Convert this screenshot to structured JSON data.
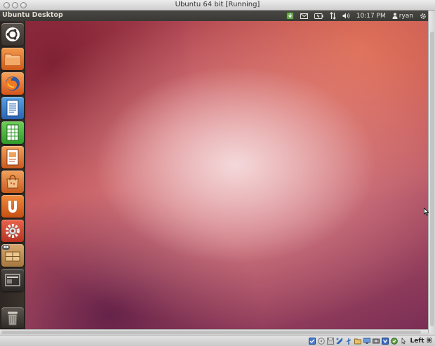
{
  "window": {
    "title": "Ubuntu 64 bit [Running]"
  },
  "panel": {
    "title": "Ubuntu Desktop",
    "time": "10:17 PM",
    "user": "ryan"
  },
  "launcher": {
    "items": [
      {
        "name": "dash-home",
        "icon": "ubuntu-logo-icon"
      },
      {
        "name": "files",
        "icon": "folder-icon"
      },
      {
        "name": "firefox",
        "icon": "firefox-icon"
      },
      {
        "name": "writer",
        "icon": "writer-icon"
      },
      {
        "name": "calc",
        "icon": "calc-icon"
      },
      {
        "name": "impress",
        "icon": "impress-icon"
      },
      {
        "name": "software-center",
        "icon": "shopping-bag-icon"
      },
      {
        "name": "ubuntu-one",
        "icon": "ubuntu-one-icon"
      },
      {
        "name": "system-settings",
        "icon": "gear-icon"
      },
      {
        "name": "workspaces",
        "icon": "workspace-icon"
      },
      {
        "name": "desktop",
        "icon": "window-icon"
      },
      {
        "name": "trash",
        "icon": "trash-icon"
      }
    ]
  },
  "statusbar": {
    "host_key": "Left ⌘"
  },
  "colors": {
    "panel": "#3c3b37",
    "launcher": "#2f2824",
    "accent": "#dd4814"
  }
}
